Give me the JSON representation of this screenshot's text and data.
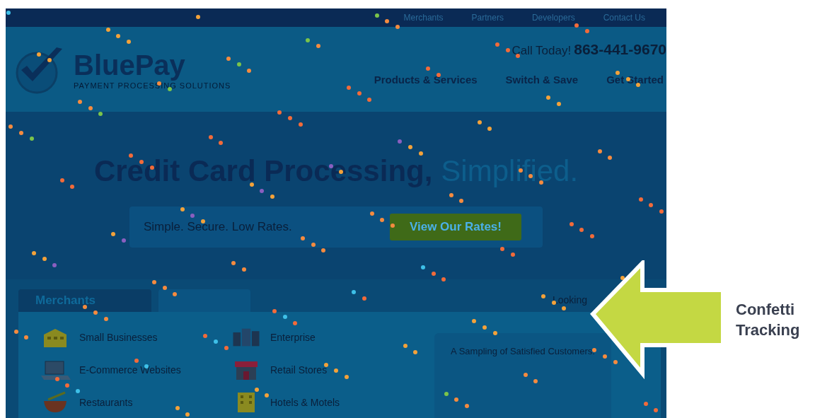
{
  "top_bar": {
    "links": [
      "Merchants",
      "Partners",
      "Developers",
      "Contact Us"
    ]
  },
  "header": {
    "logo_name": "BluePay",
    "logo_tagline": "PAYMENT PROCESSING SOLUTIONS",
    "call_label": "Call Today!",
    "phone": "863-441-9670",
    "nav": [
      "Products & Services",
      "Switch & Save",
      "Get Started"
    ]
  },
  "hero": {
    "headline": "Credit Card Processing,",
    "headline_accent": "Simplified.",
    "tagline": "Simple. Secure. Low Rates.",
    "cta": "View Our Rates!"
  },
  "tabs": [
    {
      "label": "Merchants",
      "selected": true
    }
  ],
  "looking_text": "Looking",
  "segments": [
    {
      "label": "Small Businesses",
      "kind": "building"
    },
    {
      "label": "Enterprise",
      "kind": "towers"
    },
    {
      "label": "E-Commerce Websites",
      "kind": "laptop"
    },
    {
      "label": "Retail Stores",
      "kind": "store"
    },
    {
      "label": "Restaurants",
      "kind": "bowl"
    },
    {
      "label": "Hotels & Motels",
      "kind": "hotel"
    }
  ],
  "customers_box": {
    "title": "A Sampling of Satisfied Customers:"
  },
  "annotation": {
    "label": "Confetti Tracking"
  }
}
